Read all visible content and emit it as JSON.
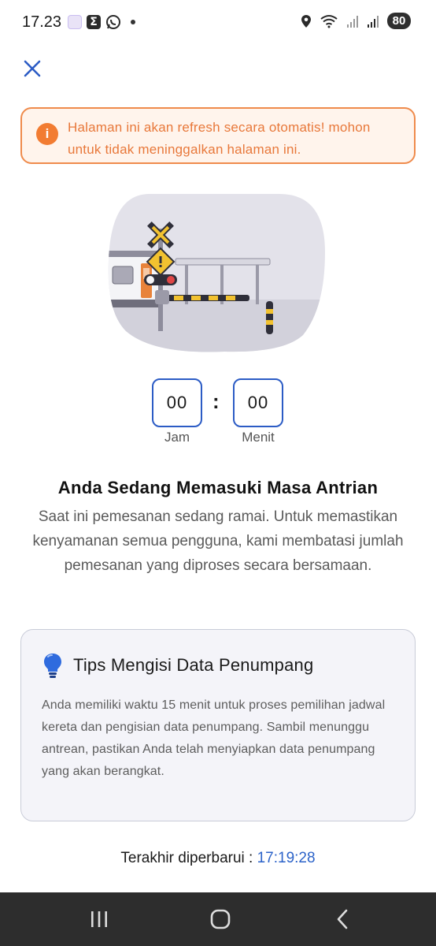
{
  "status_bar": {
    "time": "17.23",
    "battery": "80"
  },
  "alert": {
    "icon_glyph": "i",
    "message": "Halaman ini akan refresh secara otomatis! mohon untuk tidak meninggalkan halaman ini."
  },
  "timer": {
    "hours": "00",
    "minutes": "00",
    "separator": ":",
    "hours_label": "Jam",
    "minutes_label": "Menit"
  },
  "queue": {
    "title": "Anda Sedang Memasuki Masa Antrian",
    "description": "Saat ini pemesanan sedang ramai. Untuk memastikan kenyamanan semua pengguna, kami membatasi jumlah pemesanan yang diproses secara bersamaan."
  },
  "tips": {
    "title": "Tips Mengisi Data Penumpang",
    "body": "Anda memiliki waktu 15 menit untuk proses pemilihan jadwal kereta dan pengisian data penumpang. Sambil menunggu antrean, pastikan Anda telah menyiapkan data penumpang yang akan berangkat."
  },
  "last_updated": {
    "label": "Terakhir diperbarui :",
    "time": "17:19:28"
  },
  "colors": {
    "accent_blue": "#2c5cc5",
    "alert_orange": "#ef8b4c",
    "time_blue": "#2c63c9"
  },
  "icons": {
    "close": "close-icon",
    "alert": "info-icon",
    "tips": "lightbulb-icon"
  }
}
